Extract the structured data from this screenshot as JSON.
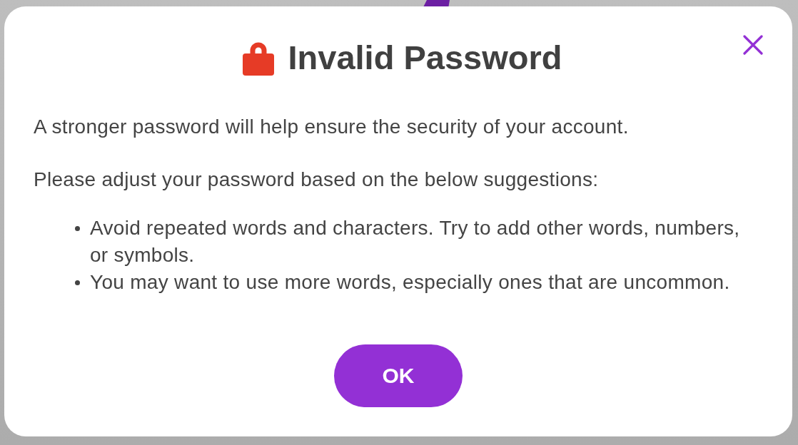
{
  "dialog": {
    "title": "Invalid Password",
    "paragraphs": [
      "A stronger password will help ensure the security of your account.",
      "Please adjust your password based on the below suggestions:"
    ],
    "suggestions": [
      "Avoid repeated words and characters. Try to add other words, numbers, or symbols.",
      "You may want to use more words, especially ones that are uncommon."
    ],
    "buttons": [
      "OK"
    ]
  }
}
